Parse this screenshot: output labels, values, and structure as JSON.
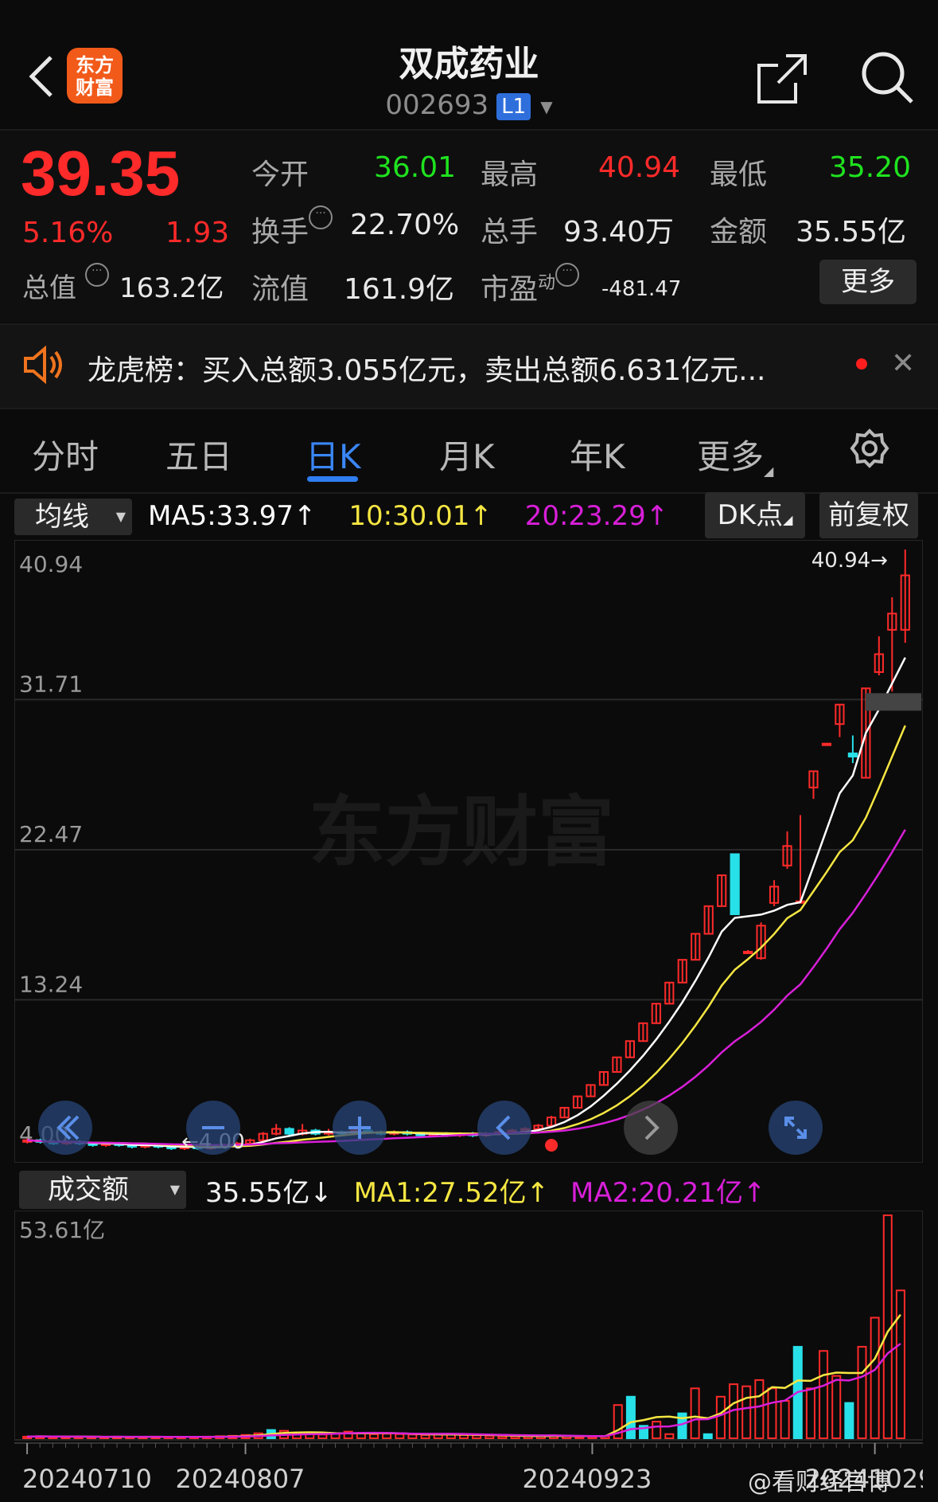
{
  "header": {
    "logo_text": "东方\n财富",
    "title": "双成药业",
    "code": "002693",
    "level": "L1"
  },
  "quote": {
    "price": "39.35",
    "change_pct": "5.16%",
    "change_abs": "1.93",
    "mktcap_label": "总值",
    "mktcap_value": "163.2亿",
    "open_label": "今开",
    "open_value": "36.01",
    "high_label": "最高",
    "high_value": "40.94",
    "low_label": "最低",
    "low_value": "35.20",
    "turnover_label": "换手",
    "turnover_value": "22.70%",
    "volume_label": "总手",
    "volume_value": "93.40万",
    "amount_label": "金额",
    "amount_value": "35.55亿",
    "float_label": "流值",
    "float_value": "161.9亿",
    "pe_label": "市盈",
    "pe_sup": "动",
    "pe_value": "-481.47",
    "more_button": "更多"
  },
  "news": {
    "text": "龙虎榜：买入总额3.055亿元，卖出总额6.631亿元..."
  },
  "tabs": [
    "分时",
    "五日",
    "日K",
    "月K",
    "年K",
    "更多"
  ],
  "active_tab": "日K",
  "indicators": {
    "main_select": "均线",
    "ma5": "MA5:33.97↑",
    "ma10": "10:30.01↑",
    "ma20": "20:23.29↑",
    "dk_button": "DK点",
    "adjust_button": "前复权",
    "vol_select": "成交额",
    "vol_value": "35.55亿↓",
    "vol_ma1": "MA1:27.52亿↑",
    "vol_ma2": "MA2:20.21亿↑"
  },
  "colors": {
    "up": "#ff2a2a",
    "down": "#28e0e8",
    "ma5": "#ffffff",
    "ma10": "#f5e642",
    "ma20": "#d81fd8",
    "accent": "#2f7df0"
  },
  "chart_data": [
    {
      "type": "candlestick",
      "y_ticks": [
        "40.94",
        "31.71",
        "22.47",
        "13.24",
        "4.00"
      ],
      "ylim": [
        4.0,
        40.94
      ],
      "high_annotation": "40.94→",
      "low_annotation": "←4.00",
      "watermark": "东方财富",
      "candles": [
        {
          "o": 4.5,
          "c": 4.6,
          "h": 4.7,
          "l": 4.4
        },
        {
          "o": 4.6,
          "c": 4.5,
          "h": 4.7,
          "l": 4.4
        },
        {
          "o": 4.5,
          "c": 4.4,
          "h": 4.6,
          "l": 4.3
        },
        {
          "o": 4.4,
          "c": 4.5,
          "h": 4.6,
          "l": 4.3
        },
        {
          "o": 4.5,
          "c": 4.4,
          "h": 4.6,
          "l": 4.3
        },
        {
          "o": 4.4,
          "c": 4.3,
          "h": 4.5,
          "l": 4.2
        },
        {
          "o": 4.3,
          "c": 4.4,
          "h": 4.5,
          "l": 4.2
        },
        {
          "o": 4.4,
          "c": 4.3,
          "h": 4.5,
          "l": 4.2
        },
        {
          "o": 4.3,
          "c": 4.2,
          "h": 4.4,
          "l": 4.1
        },
        {
          "o": 4.2,
          "c": 4.3,
          "h": 4.4,
          "l": 4.1
        },
        {
          "o": 4.3,
          "c": 4.2,
          "h": 4.4,
          "l": 4.1
        },
        {
          "o": 4.2,
          "c": 4.1,
          "h": 4.3,
          "l": 4.0
        },
        {
          "o": 4.1,
          "c": 4.2,
          "h": 4.3,
          "l": 4.0
        },
        {
          "o": 4.2,
          "c": 4.1,
          "h": 4.3,
          "l": 4.0
        },
        {
          "o": 4.1,
          "c": 4.2,
          "h": 4.3,
          "l": 4.0
        },
        {
          "o": 4.2,
          "c": 4.3,
          "h": 4.4,
          "l": 4.1
        },
        {
          "o": 4.3,
          "c": 4.4,
          "h": 4.5,
          "l": 4.2
        },
        {
          "o": 4.4,
          "c": 4.6,
          "h": 4.7,
          "l": 4.3
        },
        {
          "o": 4.6,
          "c": 5.0,
          "h": 5.1,
          "l": 4.5
        },
        {
          "o": 5.0,
          "c": 5.3,
          "h": 5.6,
          "l": 4.9
        },
        {
          "o": 5.3,
          "c": 5.0,
          "h": 5.4,
          "l": 4.9
        },
        {
          "o": 5.0,
          "c": 5.2,
          "h": 5.6,
          "l": 4.9
        },
        {
          "o": 5.2,
          "c": 5.0,
          "h": 5.3,
          "l": 4.9
        },
        {
          "o": 5.0,
          "c": 5.1,
          "h": 5.3,
          "l": 4.9
        },
        {
          "o": 5.1,
          "c": 5.0,
          "h": 5.2,
          "l": 4.9
        },
        {
          "o": 5.0,
          "c": 5.2,
          "h": 5.4,
          "l": 4.9
        },
        {
          "o": 5.2,
          "c": 5.1,
          "h": 5.3,
          "l": 5.0
        },
        {
          "o": 5.1,
          "c": 5.0,
          "h": 5.2,
          "l": 4.9
        },
        {
          "o": 5.0,
          "c": 5.1,
          "h": 5.2,
          "l": 4.9
        },
        {
          "o": 5.1,
          "c": 5.0,
          "h": 5.2,
          "l": 4.9
        },
        {
          "o": 5.0,
          "c": 4.9,
          "h": 5.1,
          "l": 4.8
        },
        {
          "o": 4.9,
          "c": 5.0,
          "h": 5.1,
          "l": 4.8
        },
        {
          "o": 5.0,
          "c": 4.9,
          "h": 5.1,
          "l": 4.8
        },
        {
          "o": 4.9,
          "c": 5.0,
          "h": 5.1,
          "l": 4.8
        },
        {
          "o": 5.0,
          "c": 4.9,
          "h": 5.1,
          "l": 4.8
        },
        {
          "o": 4.9,
          "c": 5.0,
          "h": 5.1,
          "l": 4.8
        },
        {
          "o": 5.0,
          "c": 5.1,
          "h": 5.2,
          "l": 4.9
        },
        {
          "o": 5.1,
          "c": 5.2,
          "h": 5.3,
          "l": 5.0
        },
        {
          "o": 5.2,
          "c": 5.3,
          "h": 5.4,
          "l": 5.1
        },
        {
          "o": 5.3,
          "c": 5.5,
          "h": 5.6,
          "l": 5.2
        },
        {
          "o": 5.5,
          "c": 6.0,
          "h": 6.1,
          "l": 5.4
        },
        {
          "o": 6.0,
          "c": 6.6,
          "h": 6.6,
          "l": 6.0
        },
        {
          "o": 6.6,
          "c": 7.3,
          "h": 7.3,
          "l": 6.6
        },
        {
          "o": 7.3,
          "c": 8.0,
          "h": 8.0,
          "l": 7.3
        },
        {
          "o": 8.0,
          "c": 8.8,
          "h": 8.8,
          "l": 8.0
        },
        {
          "o": 8.8,
          "c": 9.7,
          "h": 9.7,
          "l": 8.8
        },
        {
          "o": 9.7,
          "c": 10.7,
          "h": 10.7,
          "l": 9.7
        },
        {
          "o": 10.7,
          "c": 11.8,
          "h": 11.8,
          "l": 10.7
        },
        {
          "o": 11.8,
          "c": 13.0,
          "h": 13.0,
          "l": 11.8
        },
        {
          "o": 13.0,
          "c": 14.3,
          "h": 14.3,
          "l": 13.0
        },
        {
          "o": 14.3,
          "c": 15.7,
          "h": 15.7,
          "l": 14.3
        },
        {
          "o": 15.7,
          "c": 17.3,
          "h": 17.3,
          "l": 15.7
        },
        {
          "o": 17.3,
          "c": 19.0,
          "h": 19.0,
          "l": 17.3
        },
        {
          "o": 19.0,
          "c": 20.9,
          "h": 20.9,
          "l": 19.0
        },
        {
          "o": 22.2,
          "c": 18.5,
          "h": 22.2,
          "l": 18.5
        },
        {
          "o": 16.2,
          "c": 16.2,
          "h": 16.3,
          "l": 16.1
        },
        {
          "o": 15.8,
          "c": 17.8,
          "h": 18.0,
          "l": 15.7
        },
        {
          "o": 19.2,
          "c": 20.2,
          "h": 20.6,
          "l": 19.0
        },
        {
          "o": 21.5,
          "c": 22.7,
          "h": 23.6,
          "l": 21.3
        },
        {
          "o": 19.3,
          "c": 19.3,
          "h": 24.6,
          "l": 19.3
        },
        {
          "o": 26.3,
          "c": 27.3,
          "h": 27.3,
          "l": 25.6
        },
        {
          "o": 29.0,
          "c": 29.0,
          "h": 29.0,
          "l": 29.0
        },
        {
          "o": 30.2,
          "c": 31.4,
          "h": 31.4,
          "l": 29.4
        },
        {
          "o": 28.4,
          "c": 28.2,
          "h": 29.5,
          "l": 27.8
        },
        {
          "o": 26.9,
          "c": 32.4,
          "h": 32.4,
          "l": 26.9
        },
        {
          "o": 33.4,
          "c": 34.5,
          "h": 35.6,
          "l": 33.2
        },
        {
          "o": 36.0,
          "c": 37.0,
          "h": 38.0,
          "l": 32.2
        },
        {
          "o": 36.0,
          "c": 39.35,
          "h": 40.94,
          "l": 35.2
        }
      ],
      "ma_series": [
        {
          "name": "MA5",
          "label_value": "33.97"
        },
        {
          "name": "MA10",
          "label_value": "30.01"
        },
        {
          "name": "MA20",
          "label_value": "23.29"
        }
      ]
    },
    {
      "type": "bar",
      "y_ticks": [
        "53.61亿"
      ],
      "ylim": [
        0,
        53.61
      ],
      "x_tick_labels": [
        "20240710",
        "20240807",
        "20240923",
        "20241029"
      ],
      "values": [
        0.4,
        0.5,
        0.4,
        0.3,
        0.4,
        0.3,
        0.3,
        0.4,
        0.3,
        0.3,
        0.4,
        0.3,
        0.3,
        0.3,
        0.4,
        0.5,
        0.6,
        0.8,
        1.2,
        2.0,
        1.8,
        1.2,
        1.0,
        0.9,
        1.2,
        1.6,
        1.3,
        1.0,
        1.1,
        1.0,
        0.9,
        0.8,
        0.9,
        1.0,
        0.8,
        0.7,
        0.6,
        0.5,
        0.5,
        0.5,
        0.6,
        0.7,
        0.5,
        0.4,
        0.4,
        0.5,
        8.0,
        10.0,
        3.0,
        4.0,
        1.0,
        6.0,
        12.0,
        1.0,
        10.0,
        13.0,
        12.5,
        14.0,
        12.0,
        9.0,
        22.0,
        12.0,
        21.0,
        15.0,
        8.5,
        22.0,
        29.0,
        53.61,
        35.55
      ],
      "down_index": [
        19,
        47,
        48,
        51,
        53,
        60,
        64
      ],
      "series": [
        {
          "name": "MA1",
          "label_value": "27.52亿"
        },
        {
          "name": "MA2",
          "label_value": "20.21亿"
        }
      ]
    }
  ],
  "watermark_footer": "@看财经官博"
}
